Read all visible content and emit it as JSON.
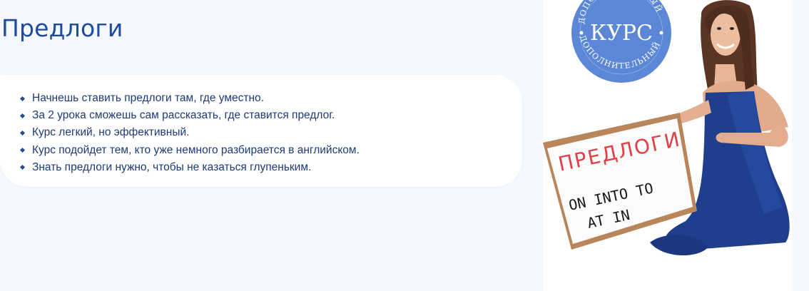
{
  "page": {
    "title": "Предлоги"
  },
  "features": [
    "Начнешь ставить предлоги там, где уместно.",
    "За 2 урока сможешь сам рассказать, где ставится предлог.",
    "Курс легкий, но эффективный.",
    "Курс подойдет тем, кто уже немного разбирается в английском.",
    "Знать предлоги нужно, чтобы не казаться глупеньким."
  ],
  "promo": {
    "badge": {
      "arc_text": "ДОПОЛНИТЕЛЬНЫЙ",
      "title": "КУРС",
      "color": "#5b87d6"
    },
    "whiteboard": {
      "heading": "ПРЕДЛОГИ",
      "heading_color": "#e0404a",
      "line1": "ON  INTO  TO",
      "line2": "AT   IN"
    },
    "dress_color": "#1f3f8c"
  },
  "colors": {
    "background": "#f5f8fe",
    "accent": "#1e4aa0",
    "text": "#1c3a78"
  }
}
